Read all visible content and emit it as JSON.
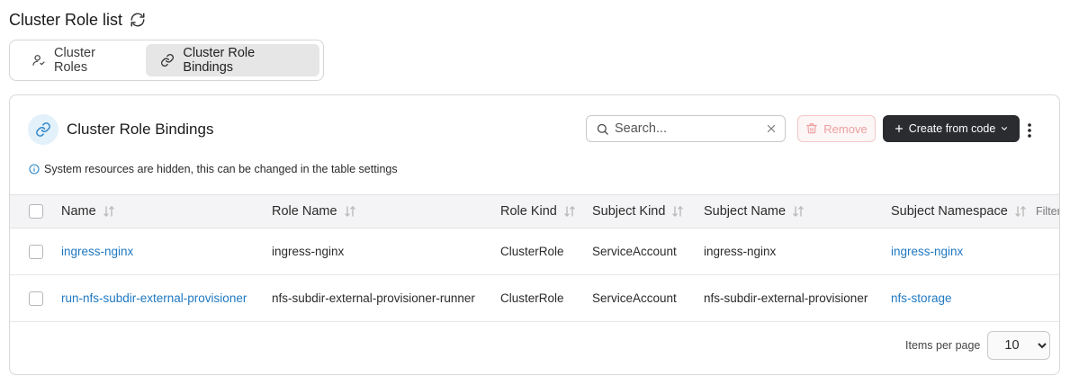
{
  "page": {
    "title": "Cluster Role list"
  },
  "tabs": [
    {
      "label": "Cluster Roles",
      "active": false,
      "icon": "user-key-icon"
    },
    {
      "label": "Cluster Role Bindings",
      "active": true,
      "icon": "link-icon"
    }
  ],
  "card": {
    "title": "Cluster Role Bindings",
    "icon": "link-icon",
    "info": "System resources are hidden, this can be changed in the table settings"
  },
  "toolbar": {
    "search_placeholder": "Search...",
    "remove_label": "Remove",
    "create_label": "Create from code"
  },
  "table": {
    "headers": {
      "name": "Name",
      "role_name": "Role Name",
      "role_kind": "Role Kind",
      "subject_kind": "Subject Kind",
      "subject_name": "Subject Name",
      "subject_namespace": "Subject Namespace",
      "filter": "Filter"
    },
    "rows": [
      {
        "name": "ingress-nginx",
        "role_name": "ingress-nginx",
        "role_kind": "ClusterRole",
        "subject_kind": "ServiceAccount",
        "subject_name": "ingress-nginx",
        "subject_namespace": "ingress-nginx"
      },
      {
        "name": "run-nfs-subdir-external-provisioner",
        "role_name": "nfs-subdir-external-provisioner-runner",
        "role_kind": "ClusterRole",
        "subject_kind": "ServiceAccount",
        "subject_name": "nfs-subdir-external-provisioner",
        "subject_namespace": "nfs-storage"
      }
    ]
  },
  "pagination": {
    "label": "Items per page",
    "value": "10",
    "options": [
      "10"
    ]
  },
  "colors": {
    "link": "#1f78c1",
    "primary_button": "#2a2c30",
    "danger_muted": "#eba0a0",
    "icon_bg": "#e3f1fa"
  }
}
